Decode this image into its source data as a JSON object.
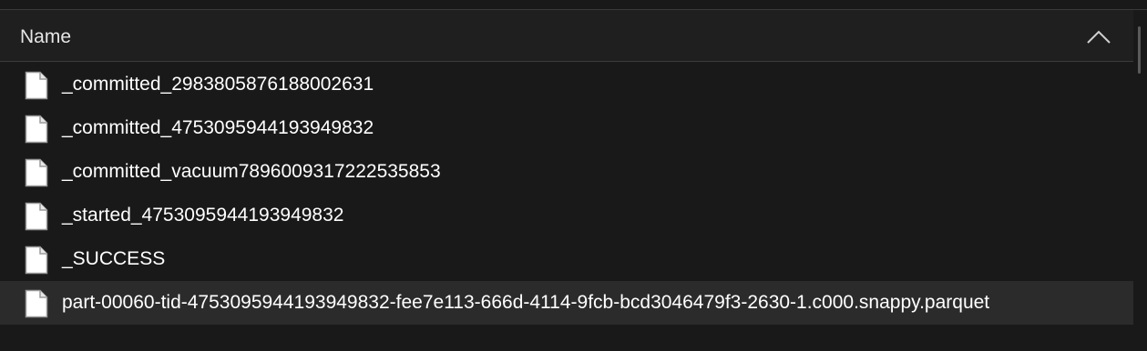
{
  "header": {
    "column_name": "Name",
    "sort_icon": "chevron-up-icon"
  },
  "files": [
    {
      "name": "_committed_2983805876188002631",
      "icon": "file-icon",
      "selected": false
    },
    {
      "name": "_committed_4753095944193949832",
      "icon": "file-icon",
      "selected": false
    },
    {
      "name": "_committed_vacuum7896009317222535853",
      "icon": "file-icon",
      "selected": false
    },
    {
      "name": "_started_4753095944193949832",
      "icon": "file-icon",
      "selected": false
    },
    {
      "name": "_SUCCESS",
      "icon": "file-icon",
      "selected": false
    },
    {
      "name": "part-00060-tid-4753095944193949832-fee7e113-666d-4114-9fcb-bcd3046479f3-2630-1.c000.snappy.parquet",
      "icon": "file-icon",
      "selected": true
    }
  ],
  "colors": {
    "background": "#191919",
    "header_background": "#1f1f1f",
    "selected_row": "#2b2b2b",
    "text": "#ffffff"
  }
}
